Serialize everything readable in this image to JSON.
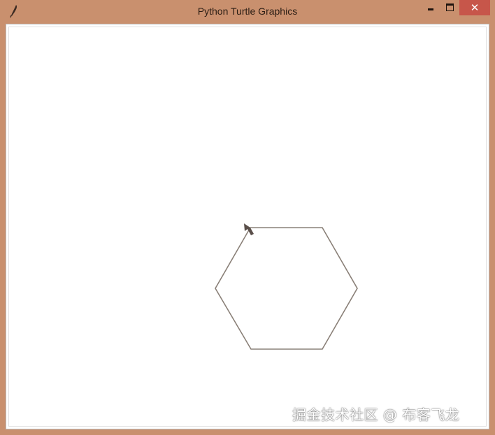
{
  "window": {
    "title": "Python Turtle Graphics",
    "close_glyph": "✕",
    "frame_color": "#c9906e",
    "close_button_color": "#c7564a"
  },
  "canvas": {
    "background": "#ffffff",
    "shape": "hexagon",
    "pen_color": "#8a8078",
    "turtle_icon": "arrow-cursor-icon"
  },
  "watermark": {
    "text": "掘金技术社区 @ 布客飞龙"
  }
}
